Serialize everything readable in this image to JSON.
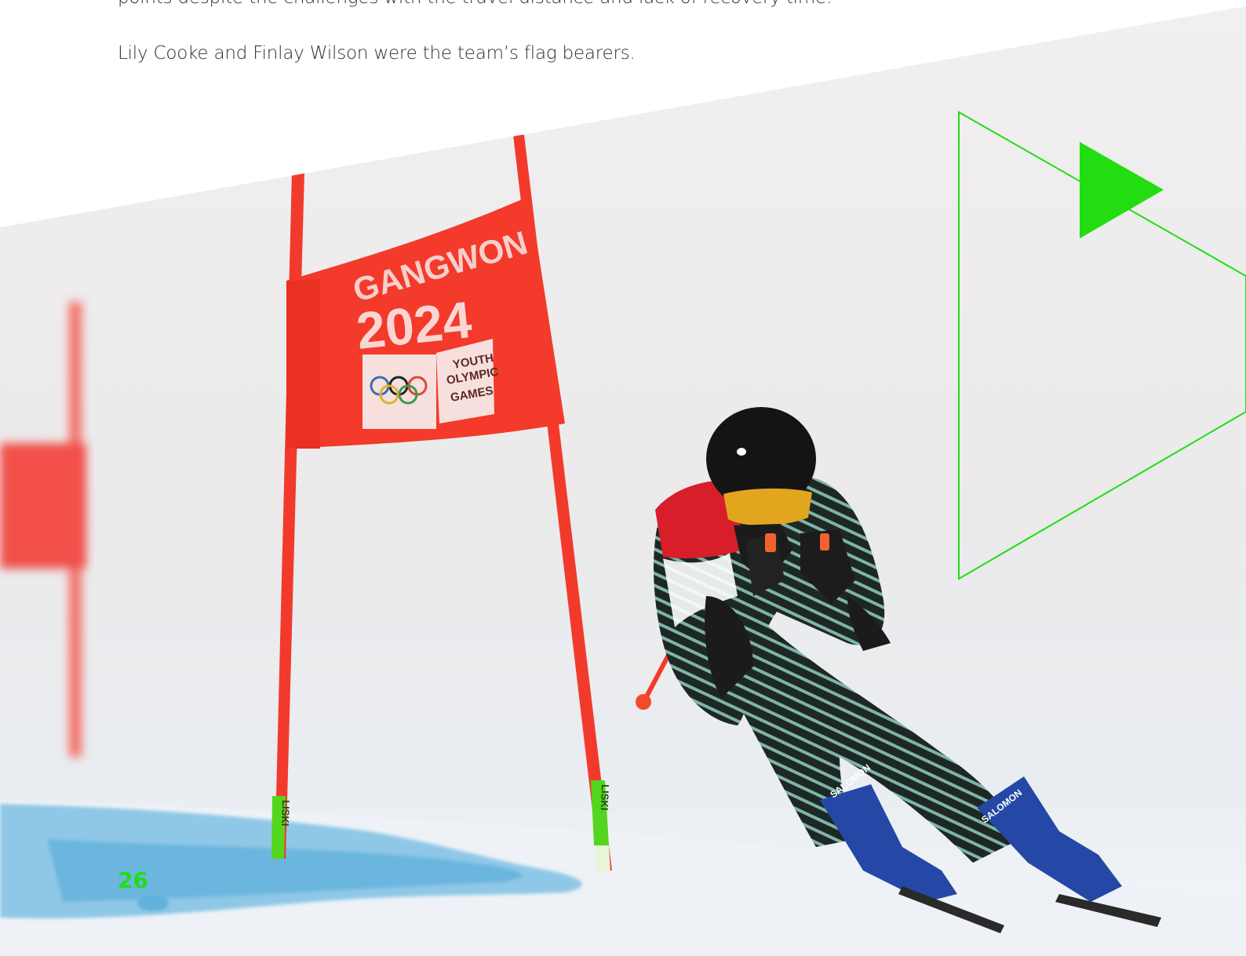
{
  "body_text": {
    "line_1": "points despite the challenges with the travel distance and lack of recovery time.",
    "line_2": "Lily Cooke and Finlay Wilson were the team’s flag bearers."
  },
  "photo": {
    "banner_text": {
      "event": "GANGWON",
      "year": "2024",
      "games_line_1": "YOUTH",
      "games_line_2": "OLYMPIC",
      "games_line_3": "GAMES"
    },
    "pole_marker_text": "LISKI",
    "boot_brand": "SALOMON"
  },
  "page_number": "26",
  "colors": {
    "accent_green": "#22dd11",
    "gate_red": "#f23a2c",
    "snow_blue_dye": "#4aa6d8"
  }
}
